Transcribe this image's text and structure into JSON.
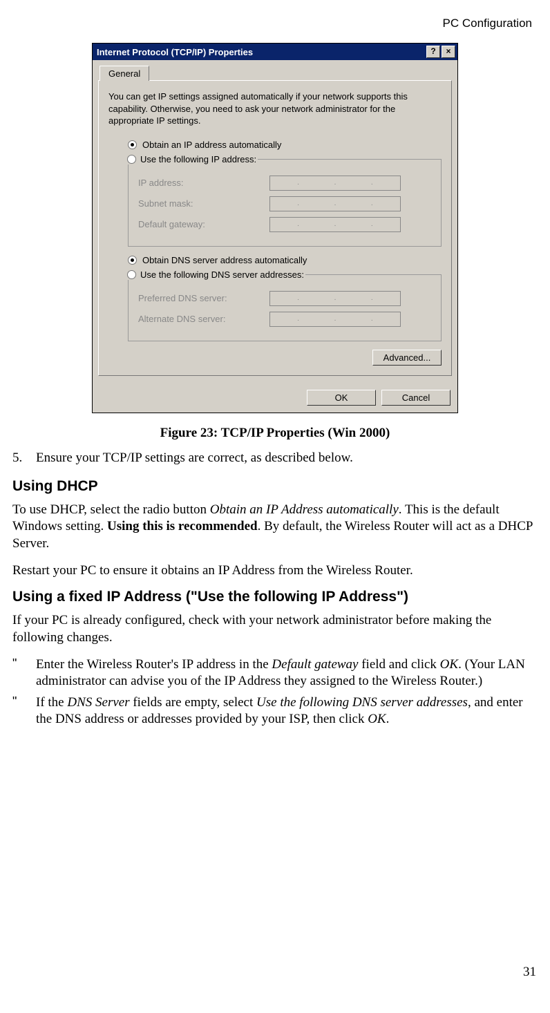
{
  "header": {
    "right": "PC Configuration"
  },
  "page_number": "31",
  "dialog": {
    "title": "Internet Protocol (TCP/IP) Properties",
    "help_btn": "?",
    "close_btn": "×",
    "tab": "General",
    "intro": "You can get IP settings assigned automatically if your network supports this capability. Otherwise, you need to ask your network administrator for the appropriate IP settings.",
    "radio_obtain_ip": "Obtain an IP address automatically",
    "radio_use_ip": "Use the following IP address:",
    "lbl_ip_address": "IP address:",
    "lbl_subnet": "Subnet mask:",
    "lbl_gateway": "Default gateway:",
    "radio_obtain_dns": "Obtain DNS server address automatically",
    "radio_use_dns": "Use the following DNS server addresses:",
    "lbl_pref_dns": "Preferred DNS server:",
    "lbl_alt_dns": "Alternate DNS server:",
    "btn_advanced": "Advanced...",
    "btn_ok": "OK",
    "btn_cancel": "Cancel"
  },
  "figure_caption": "Figure 23: TCP/IP Properties (Win 2000)",
  "step5_num": "5.",
  "step5_text": "Ensure your TCP/IP settings are correct, as described below.",
  "h_dhcp": "Using DHCP",
  "p_dhcp_1a": "To use DHCP, select the radio button ",
  "p_dhcp_1b": "Obtain an IP Address automatically",
  "p_dhcp_1c": ". This is the default Windows setting. ",
  "p_dhcp_1d": "Using this is recommended",
  "p_dhcp_1e": ". By default, the Wireless Router will act as a DHCP Server.",
  "p_dhcp_2": "Restart your PC to ensure it obtains an IP Address from the Wireless Router.",
  "h_fixed": "Using a fixed IP Address (\"Use the following IP Address\")",
  "p_fixed_1": "If your PC is already configured, check with your network administrator before making the following changes.",
  "bullet_mark": "\"",
  "b1_a": "Enter the Wireless Router's IP address in the ",
  "b1_b": "Default gateway",
  "b1_c": " field and click ",
  "b1_d": "OK",
  "b1_e": ". (Your LAN administrator can advise you of the IP Address they assigned to the Wireless Router.)",
  "b2_a": "If the ",
  "b2_b": "DNS Server",
  "b2_c": " fields are empty, select ",
  "b2_d": "Use the following DNS server addresses",
  "b2_e": ", and enter the DNS address or addresses provided by your ISP, then click ",
  "b2_f": "OK",
  "b2_g": "."
}
